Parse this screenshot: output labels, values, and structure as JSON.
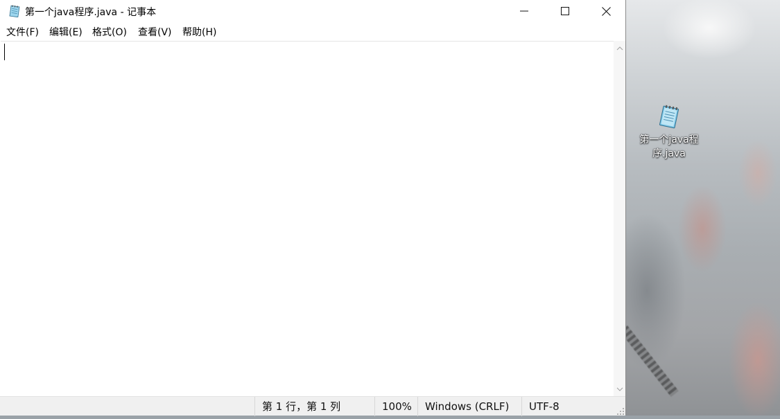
{
  "window": {
    "title": "第一个java程序.java - 记事本",
    "icon": "notepad-icon",
    "controls": [
      "minimize-icon",
      "maximize-icon",
      "close-icon"
    ]
  },
  "menu": {
    "file": "文件(F)",
    "edit": "编辑(E)",
    "format": "格式(O)",
    "view": "查看(V)",
    "help": "帮助(H)"
  },
  "editor": {
    "content": ""
  },
  "status": {
    "position": "第 1 行，第 1 列",
    "zoom": "100%",
    "line_ending": "Windows (CRLF)",
    "encoding": "UTF-8"
  },
  "desktop": {
    "icon_label": "第一个java程序.java",
    "icon": "notepad-file-icon"
  },
  "colors": {
    "window_bg": "#ffffff",
    "statusbar_bg": "#f0f0f0"
  }
}
